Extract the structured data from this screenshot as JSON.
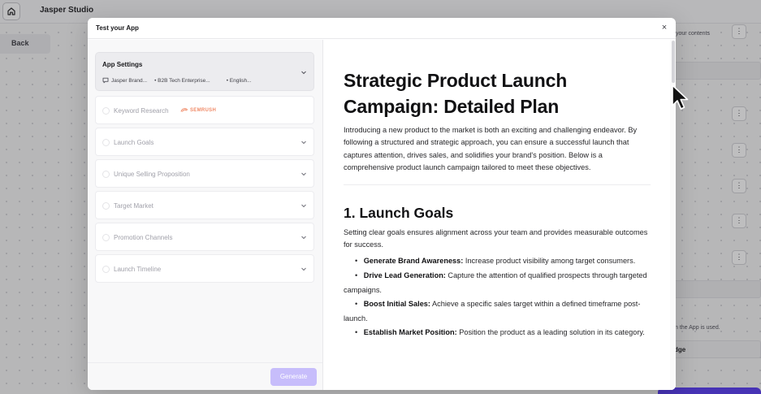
{
  "background": {
    "brand": "Jasper Studio",
    "back_label": "Back",
    "right_text_1": "your contents",
    "right_text_2": "n the App is used.",
    "right_text_3": "dge",
    "dots": "⋮"
  },
  "modal": {
    "title": "Test your App",
    "close": "×"
  },
  "left": {
    "settings": {
      "title": "App Settings",
      "meta": [
        "Jasper Brand...",
        "• B2B Tech Enterprise...",
        "• English..."
      ]
    },
    "keyword_research": {
      "label": "Keyword Research",
      "provider": "SEMRUSH"
    },
    "sections": [
      "Launch Goals",
      "Unique Selling Proposition",
      "Target Market",
      "Promotion Channels",
      "Launch Timeline"
    ],
    "generate_label": "Generate"
  },
  "doc": {
    "title": "Strategic Product Launch Campaign: Detailed Plan",
    "intro": "Introducing a new product to the market is both an exciting and challenging endeavor. By following a structured and strategic approach, you can ensure a successful launch that captures attention, drives sales, and solidifies your brand's position. Below is a comprehensive product launch campaign tailored to meet these objectives.",
    "h2": "1. Launch Goals",
    "goals_intro": "Setting clear goals ensures alignment across your team and provides measurable outcomes for success.",
    "bullets": [
      {
        "bold": "Generate Brand Awareness:",
        "text": " Increase product visibility among target consumers."
      },
      {
        "bold": "Drive Lead Generation:",
        "text": " Capture the attention of qualified prospects through targeted campaigns."
      },
      {
        "bold": "Boost Initial Sales:",
        "text": " Achieve a specific sales target within a defined timeframe post-launch."
      },
      {
        "bold": "Establish Market Position:",
        "text": " Position the product as a leading solution in its category."
      }
    ]
  },
  "colors": {
    "accent": "#5b3ff2",
    "generate_disabled": "#c7bdfb",
    "semrush": "#f08c6a"
  }
}
